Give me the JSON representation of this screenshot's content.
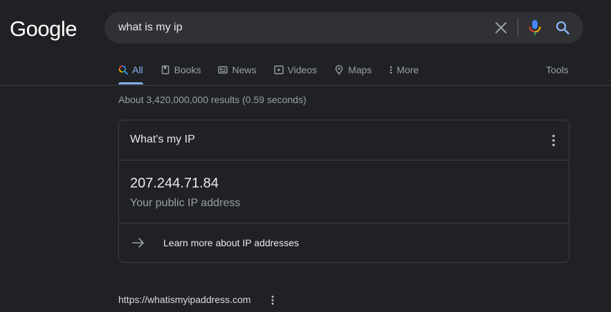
{
  "logo": {
    "text": "Google"
  },
  "search": {
    "query": "what is my ip"
  },
  "tabs": [
    {
      "label": "All",
      "icon": "search-icon",
      "active": true
    },
    {
      "label": "Books",
      "icon": "book-icon"
    },
    {
      "label": "News",
      "icon": "news-icon"
    },
    {
      "label": "Videos",
      "icon": "play-icon"
    },
    {
      "label": "Maps",
      "icon": "map-pin-icon"
    },
    {
      "label": "More",
      "icon": "more-vert-icon"
    }
  ],
  "tools_label": "Tools",
  "result_stats": "About 3,420,000,000 results (0.59 seconds)",
  "ip_card": {
    "title": "What's my IP",
    "ip": "207.244.71.84",
    "caption": "Your public IP address",
    "learn_more": "Learn more about IP addresses"
  },
  "first_result": {
    "url": "https://whatismyipaddress.com"
  },
  "colors": {
    "background": "#202124",
    "accent": "#8ab4f8",
    "searchbox": "#303134"
  }
}
